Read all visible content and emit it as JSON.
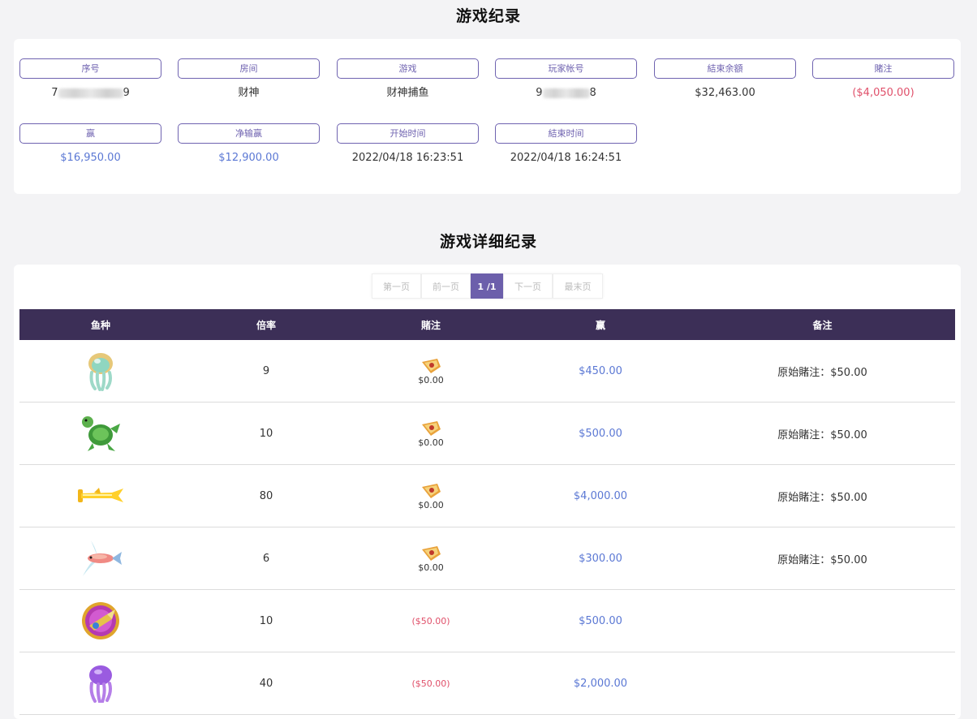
{
  "summary": {
    "title": "游戏纪录",
    "fields": [
      {
        "label": "序号",
        "value_prefix": "7",
        "value_suffix": "9"
      },
      {
        "label": "房间",
        "value": "财神"
      },
      {
        "label": "游戏",
        "value": "财神捕鱼"
      },
      {
        "label": "玩家帐号",
        "value_prefix": "9",
        "value_suffix": "8"
      },
      {
        "label": "結束余額",
        "value": "$32,463.00"
      },
      {
        "label": "賭注",
        "value": "($4,050.00)"
      },
      {
        "label": "赢",
        "value": "$16,950.00"
      },
      {
        "label": "净输赢",
        "value": "$12,900.00"
      },
      {
        "label": "开始时间",
        "value": "2022/04/18 16:23:51"
      },
      {
        "label": "結束时间",
        "value": "2022/04/18 16:24:51"
      }
    ]
  },
  "detail": {
    "title": "游戏详细纪录",
    "pager": {
      "first": "第一页",
      "prev": "前一页",
      "current": "1 /1",
      "next": "下一页",
      "last": "最末页"
    },
    "columns": [
      "鱼种",
      "倍率",
      "賭注",
      "赢",
      "备注"
    ],
    "rows": [
      {
        "fish_icon": "jellyfish-green-icon",
        "rate": "9",
        "bet": "$0.00",
        "bet_icon": "coupon-icon",
        "win": "$450.00",
        "note": "原始賭注：$50.00"
      },
      {
        "fish_icon": "turtle-icon",
        "rate": "10",
        "bet": "$0.00",
        "bet_icon": "coupon-icon",
        "win": "$500.00",
        "note": "原始賭注：$50.00"
      },
      {
        "fish_icon": "golden-hammerhead-icon",
        "rate": "80",
        "bet": "$0.00",
        "bet_icon": "coupon-icon",
        "win": "$4,000.00",
        "note": "原始賭注：$50.00"
      },
      {
        "fish_icon": "flying-fish-icon",
        "rate": "6",
        "bet": "$0.00",
        "bet_icon": "coupon-icon",
        "win": "$300.00",
        "note": "原始賭注：$50.00"
      },
      {
        "fish_icon": "drill-medal-icon",
        "rate": "10",
        "bet": "($50.00)",
        "win": "$500.00",
        "note": ""
      },
      {
        "fish_icon": "jellyfish-purple-icon",
        "rate": "40",
        "bet": "($50.00)",
        "win": "$2,000.00",
        "note": ""
      }
    ]
  },
  "colors": {
    "accent": "#6c5fab",
    "header_bg": "#3c2f57",
    "win": "#5b78d4",
    "negative": "#e0506a"
  }
}
